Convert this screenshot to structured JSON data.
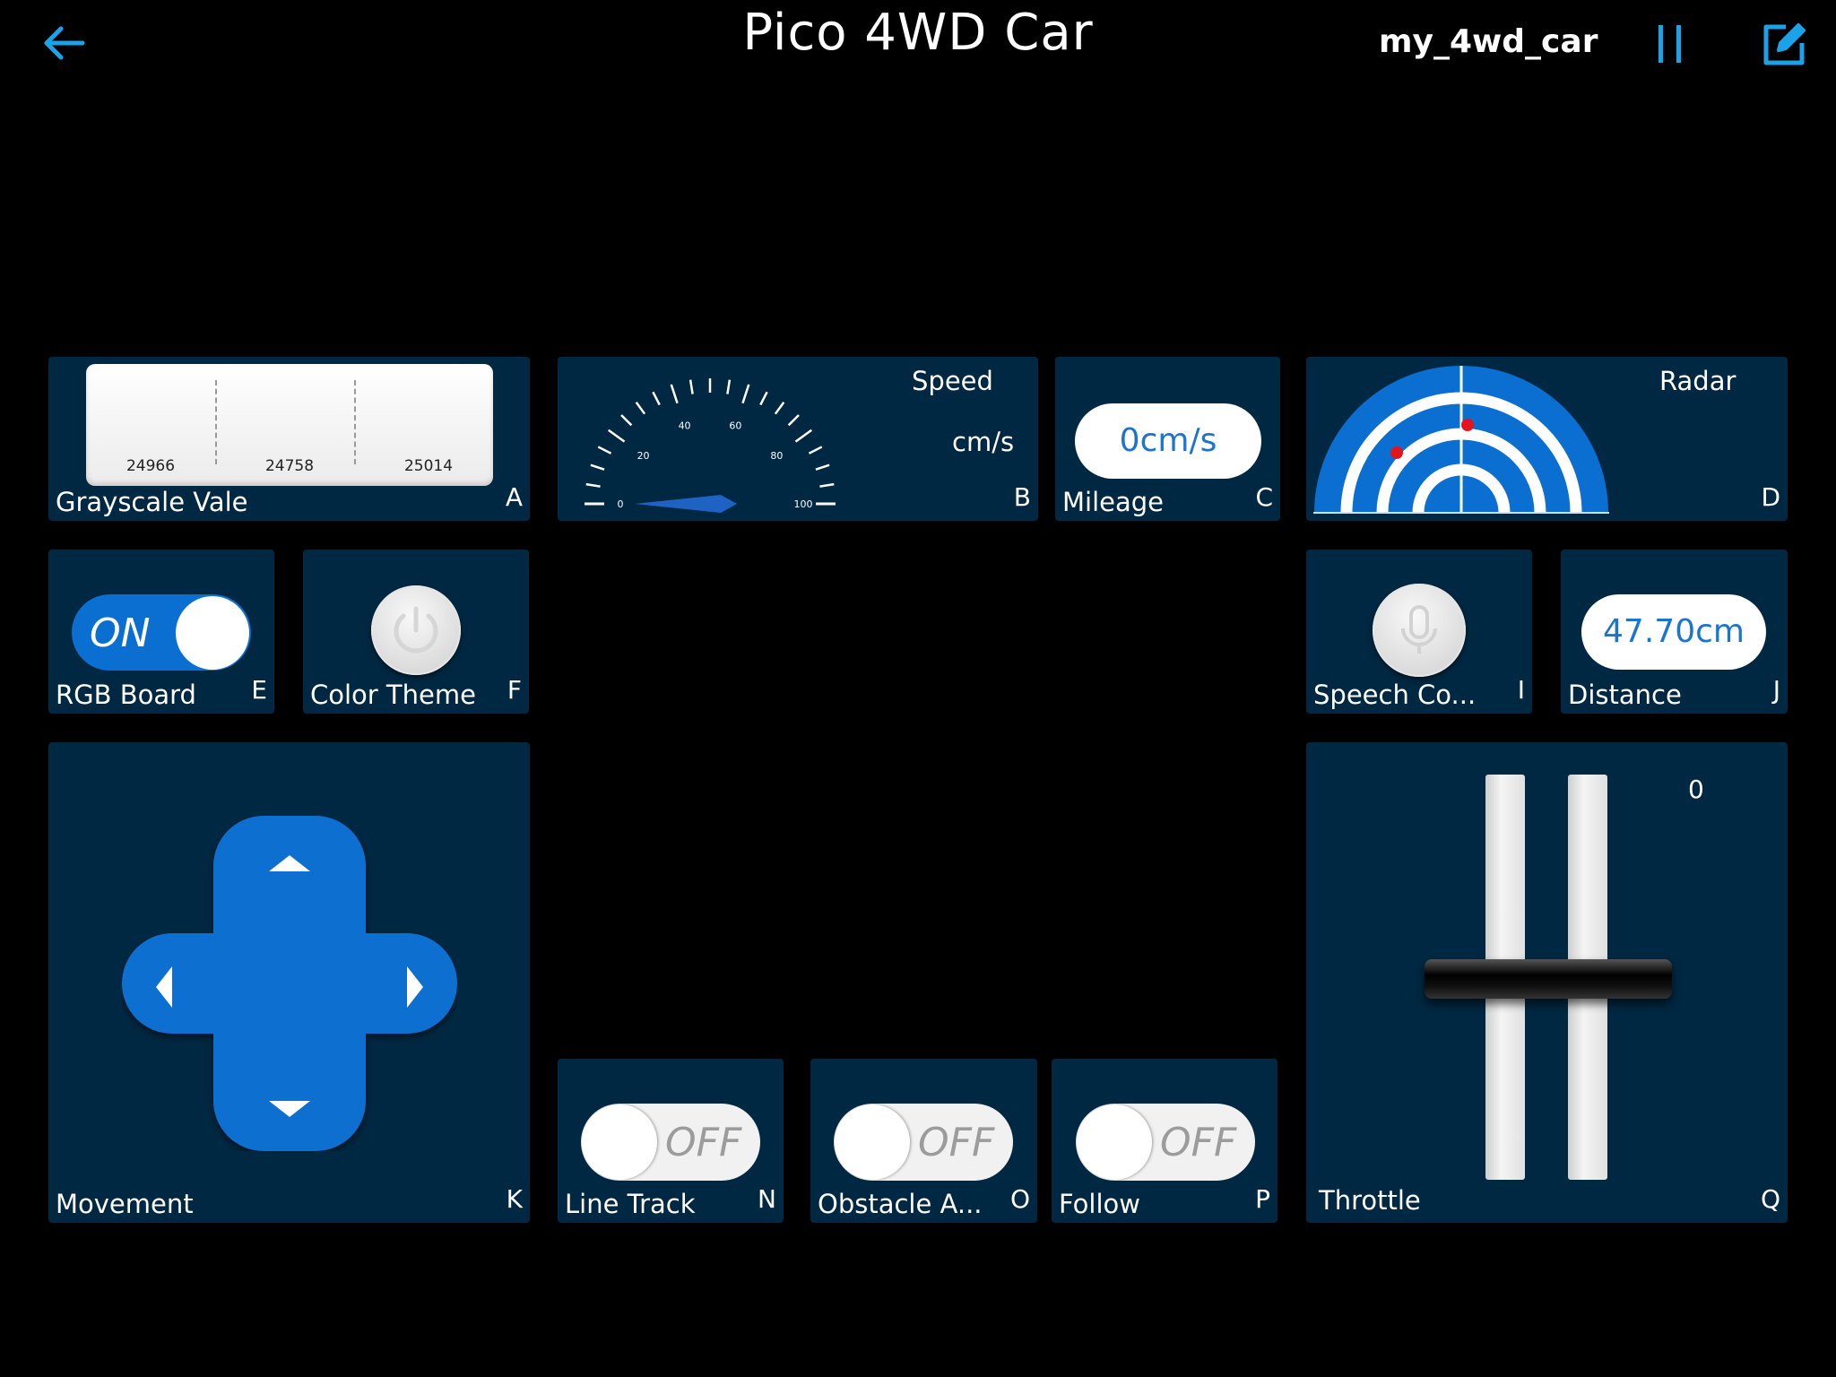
{
  "header": {
    "title": "Pico 4WD Car",
    "device_name": "my_4wd_car",
    "back_icon": "arrow-left-icon",
    "pause_icon": "pause-icon",
    "edit_icon": "edit-icon"
  },
  "colors": {
    "background": "#000000",
    "tile": "#012842",
    "accent": "#0a6fd0",
    "radar_dot": "#e3141b"
  },
  "grayscale": {
    "label": "Grayscale Vale",
    "key": "A",
    "values": [
      "24966",
      "24758",
      "25014"
    ]
  },
  "speed": {
    "title": "Speed",
    "unit": "cm/s",
    "key": "B",
    "ticks": [
      "0",
      "20",
      "40",
      "60",
      "80",
      "100"
    ],
    "value": 0
  },
  "mileage": {
    "label": "Mileage",
    "key": "C",
    "value": "0cm/s"
  },
  "radar": {
    "title": "Radar",
    "key": "D"
  },
  "rgb_board": {
    "label": "RGB Board",
    "key": "E",
    "state": "ON"
  },
  "color_theme": {
    "label": "Color Theme",
    "key": "F",
    "icon": "power-icon"
  },
  "speech": {
    "label": "Speech Co...",
    "key": "I",
    "icon": "microphone-icon"
  },
  "distance": {
    "label": "Distance",
    "key": "J",
    "value": "47.70cm"
  },
  "movement": {
    "label": "Movement",
    "key": "K"
  },
  "line_track": {
    "label": "Line Track",
    "key": "N",
    "state": "OFF"
  },
  "obstacle": {
    "label": "Obstacle A...",
    "key": "O",
    "state": "OFF"
  },
  "follow": {
    "label": "Follow",
    "key": "P",
    "state": "OFF"
  },
  "throttle": {
    "label": "Throttle",
    "key": "Q",
    "value": "0"
  }
}
